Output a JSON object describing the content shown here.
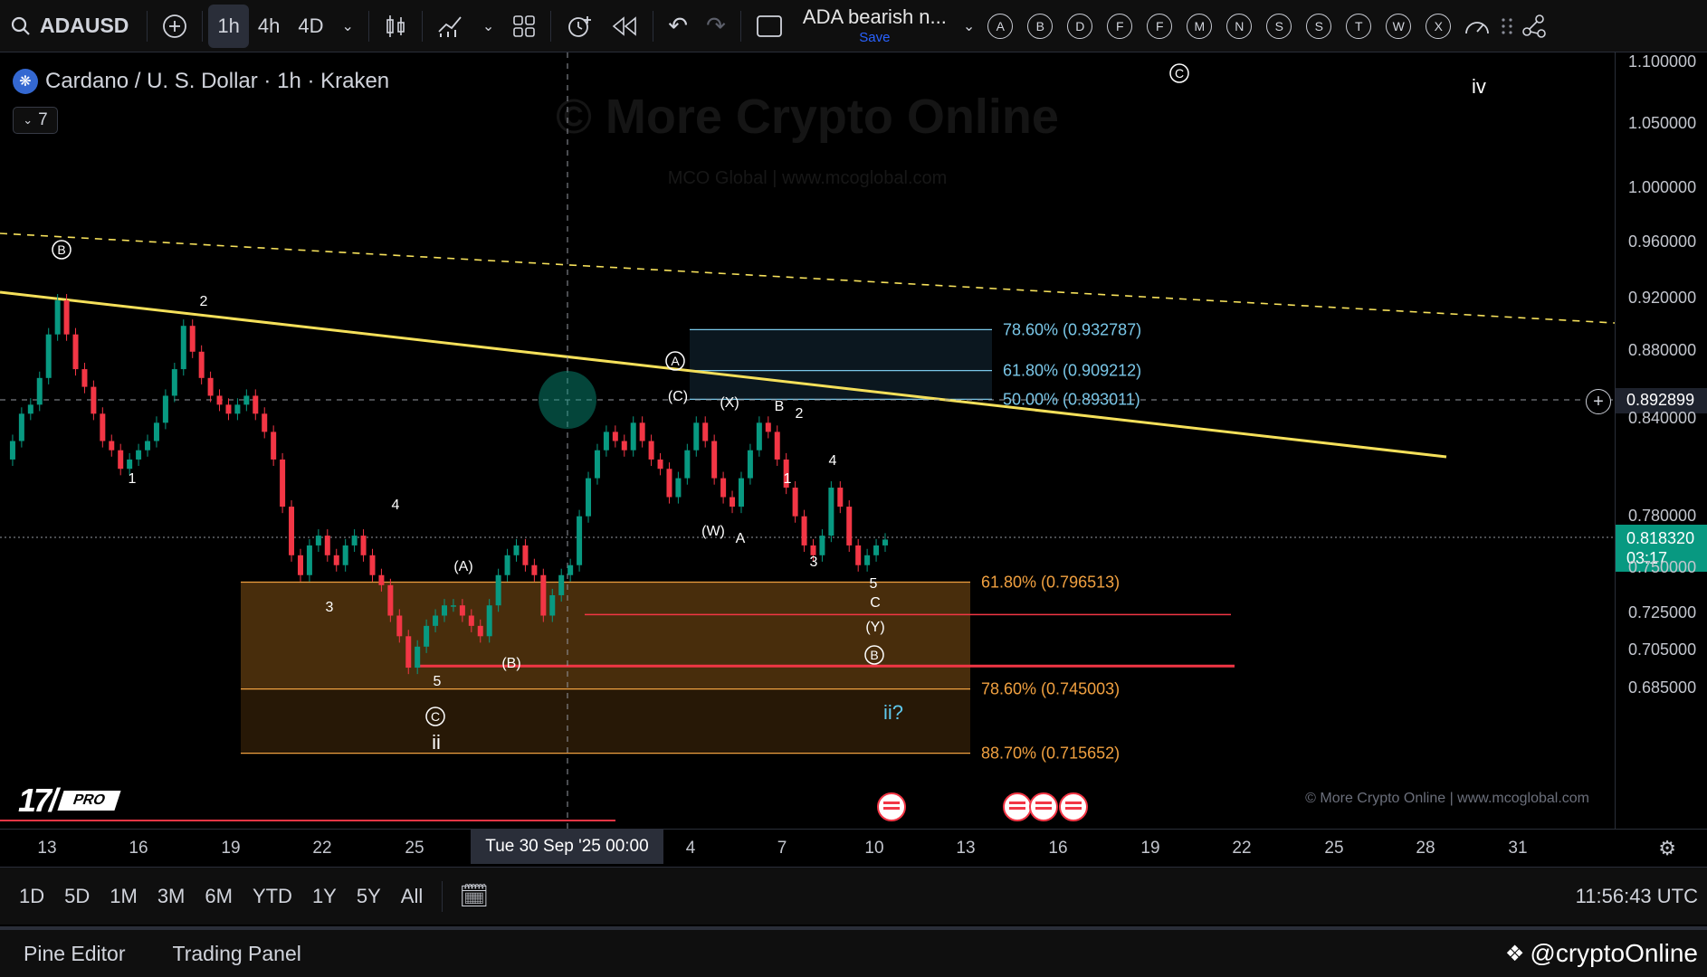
{
  "toolbar": {
    "symbol": "ADAUSD",
    "intervals": [
      "1h",
      "4h",
      "4D"
    ],
    "active_interval": "1h",
    "layout_name": "ADA bearish n...",
    "save_label": "Save",
    "letter_buttons": [
      "A",
      "B",
      "D",
      "F",
      "F",
      "M",
      "N",
      "S",
      "S",
      "T",
      "W",
      "X"
    ]
  },
  "legend": {
    "title": "Cardano / U. S. Dollar · 1h · Kraken",
    "indicator_count": "7"
  },
  "watermark": {
    "title": "© More Crypto Online",
    "subtitle": "MCO Global   |   www.mcoglobal.com",
    "copyright": "© More Crypto Online   |   www.mcoglobal.com"
  },
  "tv_logo": {
    "badge": "PRO"
  },
  "price_axis": {
    "labels": [
      "1.100000",
      "1.050000",
      "1.000000",
      "0.960000",
      "0.920000",
      "0.880000",
      "0.840000",
      "0.780000",
      "0.750000",
      "0.725000",
      "0.705000",
      "0.685000"
    ],
    "crosshair_price": "0.892899",
    "current_price": "0.818320",
    "countdown": "03:17"
  },
  "time_axis": {
    "labels": [
      "13",
      "16",
      "19",
      "22",
      "25",
      "4",
      "7",
      "10",
      "13",
      "16",
      "19",
      "22",
      "25",
      "28",
      "31"
    ],
    "crosshair_label": "Tue 30 Sep '25   00:00"
  },
  "range_bar": {
    "ranges": [
      "1D",
      "5D",
      "1M",
      "3M",
      "6M",
      "YTD",
      "1Y",
      "5Y",
      "All"
    ],
    "clock": "11:56:43 UTC"
  },
  "bottom_panel": {
    "tabs": [
      "Pine Editor",
      "Trading Panel"
    ],
    "brand": "@cryptoOnline"
  },
  "colors": {
    "up": "#089981",
    "trendline": "#f5e05a",
    "fib_orange": "#f0a040",
    "fib_blue": "#7ac7e8",
    "support_red": "#f23645"
  },
  "chart_data": {
    "type": "candlestick",
    "y_scale": "log",
    "ylim": [
      0.685,
      1.1
    ],
    "fib_retracements_upper": [
      {
        "label": "78.60% (0.932787)",
        "value": 0.932787
      },
      {
        "label": "61.80% (0.909212)",
        "value": 0.909212
      },
      {
        "label": "50.00% (0.893011)",
        "value": 0.893011
      }
    ],
    "fib_retracements_lower": [
      {
        "label": "61.80% (0.796513)",
        "value": 0.796513
      },
      {
        "label": "78.60% (0.745003)",
        "value": 0.745003
      },
      {
        "label": "88.70% (0.715652)",
        "value": 0.715652
      }
    ],
    "wave_labels": [
      "B",
      "2",
      "1",
      "3",
      "4",
      "(A)",
      "5",
      "(B)",
      "C",
      "ii",
      "A",
      "(C)",
      "(X)",
      "(W)",
      "A",
      "B",
      "2",
      "1",
      "3",
      "4",
      "5",
      "C",
      "(Y)",
      "B",
      "ii?",
      "C",
      "iv"
    ],
    "price_path": [
      0.86,
      0.87,
      0.885,
      0.89,
      0.905,
      0.93,
      0.95,
      0.93,
      0.91,
      0.9,
      0.885,
      0.87,
      0.865,
      0.855,
      0.86,
      0.865,
      0.87,
      0.88,
      0.895,
      0.91,
      0.935,
      0.92,
      0.905,
      0.895,
      0.89,
      0.885,
      0.89,
      0.895,
      0.885,
      0.875,
      0.86,
      0.835,
      0.81,
      0.8,
      0.815,
      0.82,
      0.81,
      0.805,
      0.815,
      0.82,
      0.81,
      0.8,
      0.795,
      0.78,
      0.77,
      0.755,
      0.765,
      0.775,
      0.78,
      0.785,
      0.785,
      0.78,
      0.775,
      0.77,
      0.785,
      0.8,
      0.81,
      0.815,
      0.805,
      0.8,
      0.78,
      0.79,
      0.8,
      0.805,
      0.83,
      0.85,
      0.865,
      0.875,
      0.87,
      0.865,
      0.88,
      0.87,
      0.86,
      0.855,
      0.84,
      0.85,
      0.865,
      0.88,
      0.87,
      0.85,
      0.84,
      0.835,
      0.85,
      0.865,
      0.88,
      0.875,
      0.86,
      0.845,
      0.83,
      0.815,
      0.81,
      0.82,
      0.845,
      0.835,
      0.815,
      0.805,
      0.81,
      0.815,
      0.818
    ]
  }
}
